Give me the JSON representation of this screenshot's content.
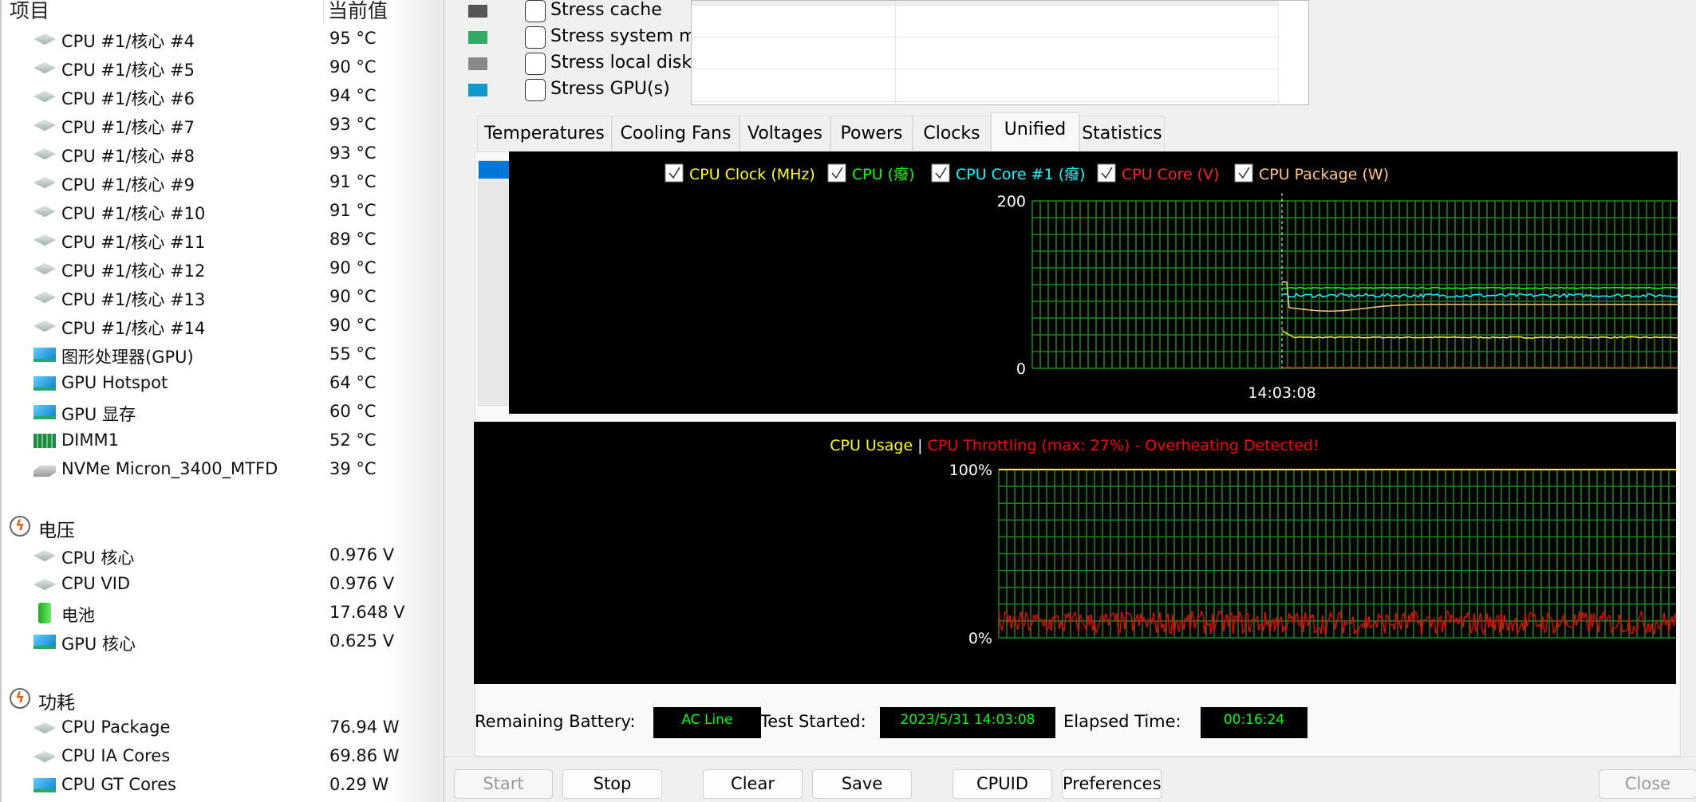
{
  "sensor_panel": {
    "col_item": "项目",
    "col_value": "当前值",
    "rows": [
      {
        "type": "item",
        "icon": "cpu-chip-icon",
        "label": "CPU #1/核心 #4",
        "value": "95 °C"
      },
      {
        "type": "item",
        "icon": "cpu-chip-icon",
        "label": "CPU #1/核心 #5",
        "value": "90 °C"
      },
      {
        "type": "item",
        "icon": "cpu-chip-icon",
        "label": "CPU #1/核心 #6",
        "value": "94 °C"
      },
      {
        "type": "item",
        "icon": "cpu-chip-icon",
        "label": "CPU #1/核心 #7",
        "value": "93 °C"
      },
      {
        "type": "item",
        "icon": "cpu-chip-icon",
        "label": "CPU #1/核心 #8",
        "value": "93 °C"
      },
      {
        "type": "item",
        "icon": "cpu-chip-icon",
        "label": "CPU #1/核心 #9",
        "value": "91 °C"
      },
      {
        "type": "item",
        "icon": "cpu-chip-icon",
        "label": "CPU #1/核心 #10",
        "value": "91 °C"
      },
      {
        "type": "item",
        "icon": "cpu-chip-icon",
        "label": "CPU #1/核心 #11",
        "value": "89 °C"
      },
      {
        "type": "item",
        "icon": "cpu-chip-icon",
        "label": "CPU #1/核心 #12",
        "value": "90 °C"
      },
      {
        "type": "item",
        "icon": "cpu-chip-icon",
        "label": "CPU #1/核心 #13",
        "value": "90 °C"
      },
      {
        "type": "item",
        "icon": "cpu-chip-icon",
        "label": "CPU #1/核心 #14",
        "value": "90 °C"
      },
      {
        "type": "item",
        "icon": "gpu-card-icon",
        "label": "图形处理器(GPU)",
        "value": "55 °C"
      },
      {
        "type": "item",
        "icon": "gpu-card-icon",
        "label": "GPU Hotspot",
        "value": "64 °C"
      },
      {
        "type": "item",
        "icon": "gpu-card-icon",
        "label": "GPU 显存",
        "value": "60 °C"
      },
      {
        "type": "item",
        "icon": "memory-dimm-icon",
        "label": "DIMM1",
        "value": "52 °C"
      },
      {
        "type": "item",
        "icon": "disk-drive-icon",
        "label": "NVMe Micron_3400_MTFD",
        "value": "39 °C"
      },
      {
        "type": "blank"
      },
      {
        "type": "section",
        "icon": "lightning-icon",
        "label": "电压"
      },
      {
        "type": "item",
        "icon": "cpu-chip-icon",
        "label": "CPU 核心",
        "value": "0.976 V"
      },
      {
        "type": "item",
        "icon": "cpu-chip-icon",
        "label": "CPU VID",
        "value": "0.976 V"
      },
      {
        "type": "item",
        "icon": "battery-icon",
        "label": "电池",
        "value": "17.648 V"
      },
      {
        "type": "item",
        "icon": "gpu-card-icon",
        "label": "GPU 核心",
        "value": "0.625 V"
      },
      {
        "type": "blank"
      },
      {
        "type": "section",
        "icon": "lightning-icon",
        "label": "功耗"
      },
      {
        "type": "item",
        "icon": "cpu-chip-icon",
        "label": "CPU Package",
        "value": "76.94 W"
      },
      {
        "type": "item",
        "icon": "cpu-chip-icon",
        "label": "CPU IA Cores",
        "value": "69.86 W"
      },
      {
        "type": "item",
        "icon": "gpu-card-icon",
        "label": "CPU GT Cores",
        "value": "0.29 W"
      }
    ]
  },
  "stress": [
    {
      "label": "Stress cache",
      "icon": "cache-chip-icon",
      "checked": false
    },
    {
      "label": "Stress system mem",
      "icon": "memory-icon",
      "checked": false
    },
    {
      "label": "Stress local disks",
      "icon": "disk-icon",
      "checked": false
    },
    {
      "label": "Stress GPU(s)",
      "icon": "gpu-icon",
      "checked": false
    }
  ],
  "tabs": [
    "Temperatures",
    "Cooling Fans",
    "Voltages",
    "Powers",
    "Clocks",
    "Unified",
    "Statistics"
  ],
  "active_tab": "Unified",
  "chart_data": [
    {
      "type": "line",
      "ylim": [
        0,
        200
      ],
      "y_ticks": [
        "200",
        "0"
      ],
      "x_marker_label": "14:03:08",
      "grid": true,
      "legend": [
        {
          "label": "CPU Clock (MHz)",
          "color": "#ffff00",
          "checked": true
        },
        {
          "label": "CPU (癈)",
          "color": "#00ff00",
          "checked": true
        },
        {
          "label": "CPU Core #1 (癈)",
          "color": "#00ffff",
          "checked": true
        },
        {
          "label": "CPU Core (V)",
          "color": "#ff2020",
          "checked": true
        },
        {
          "label": "CPU Package (W)",
          "color": "#ffc880",
          "checked": true
        }
      ],
      "series": [
        {
          "name": "CPU Clock (MHz)",
          "last_label": "3691",
          "value": 3691,
          "plot_scale": 0.01,
          "color": "#ffff00"
        },
        {
          "name": "CPU (癈)",
          "last_label": "96",
          "value": 96,
          "plot_scale": 1,
          "color": "#00ff00"
        },
        {
          "name": "CPU Core #1 (癈)",
          "last_label": "87",
          "value": 87,
          "plot_scale": 1,
          "color": "#00ffff"
        },
        {
          "name": "CPU Core (V)",
          "last_label": "0.928",
          "value": 0.928,
          "plot_scale": 1,
          "color": "#ff2020"
        },
        {
          "name": "CPU Package (W)",
          "last_label": "76.39",
          "value": 76.39,
          "plot_scale": 1,
          "color": "#ffc880"
        }
      ]
    },
    {
      "type": "line",
      "ylim": [
        0,
        100
      ],
      "y_ticks_left": [
        "100%",
        "0%"
      ],
      "grid": true,
      "title_usage": "CPU Usage",
      "title_sep": "|",
      "title_throttle": "CPU Throttling (max: 27%) - Overheating Detected!",
      "series": [
        {
          "name": "CPU Usage",
          "value": 100,
          "last_label": "100%",
          "color": "#ffff00"
        },
        {
          "name": "CPU Throttling",
          "value": 9,
          "max": 27,
          "last_label": "9%",
          "color": "#ff0000"
        }
      ]
    }
  ],
  "status": {
    "battery_label": "Remaining Battery:",
    "battery_value": "AC Line",
    "started_label": "Test Started:",
    "started_value": "2023/5/31 14:03:08",
    "elapsed_label": "Elapsed Time:",
    "elapsed_value": "00:16:24"
  },
  "buttons": {
    "start": "Start",
    "stop": "Stop",
    "clear": "Clear",
    "save": "Save",
    "cpuid": "CPUID",
    "preferences": "Preferences",
    "close": "Close"
  }
}
